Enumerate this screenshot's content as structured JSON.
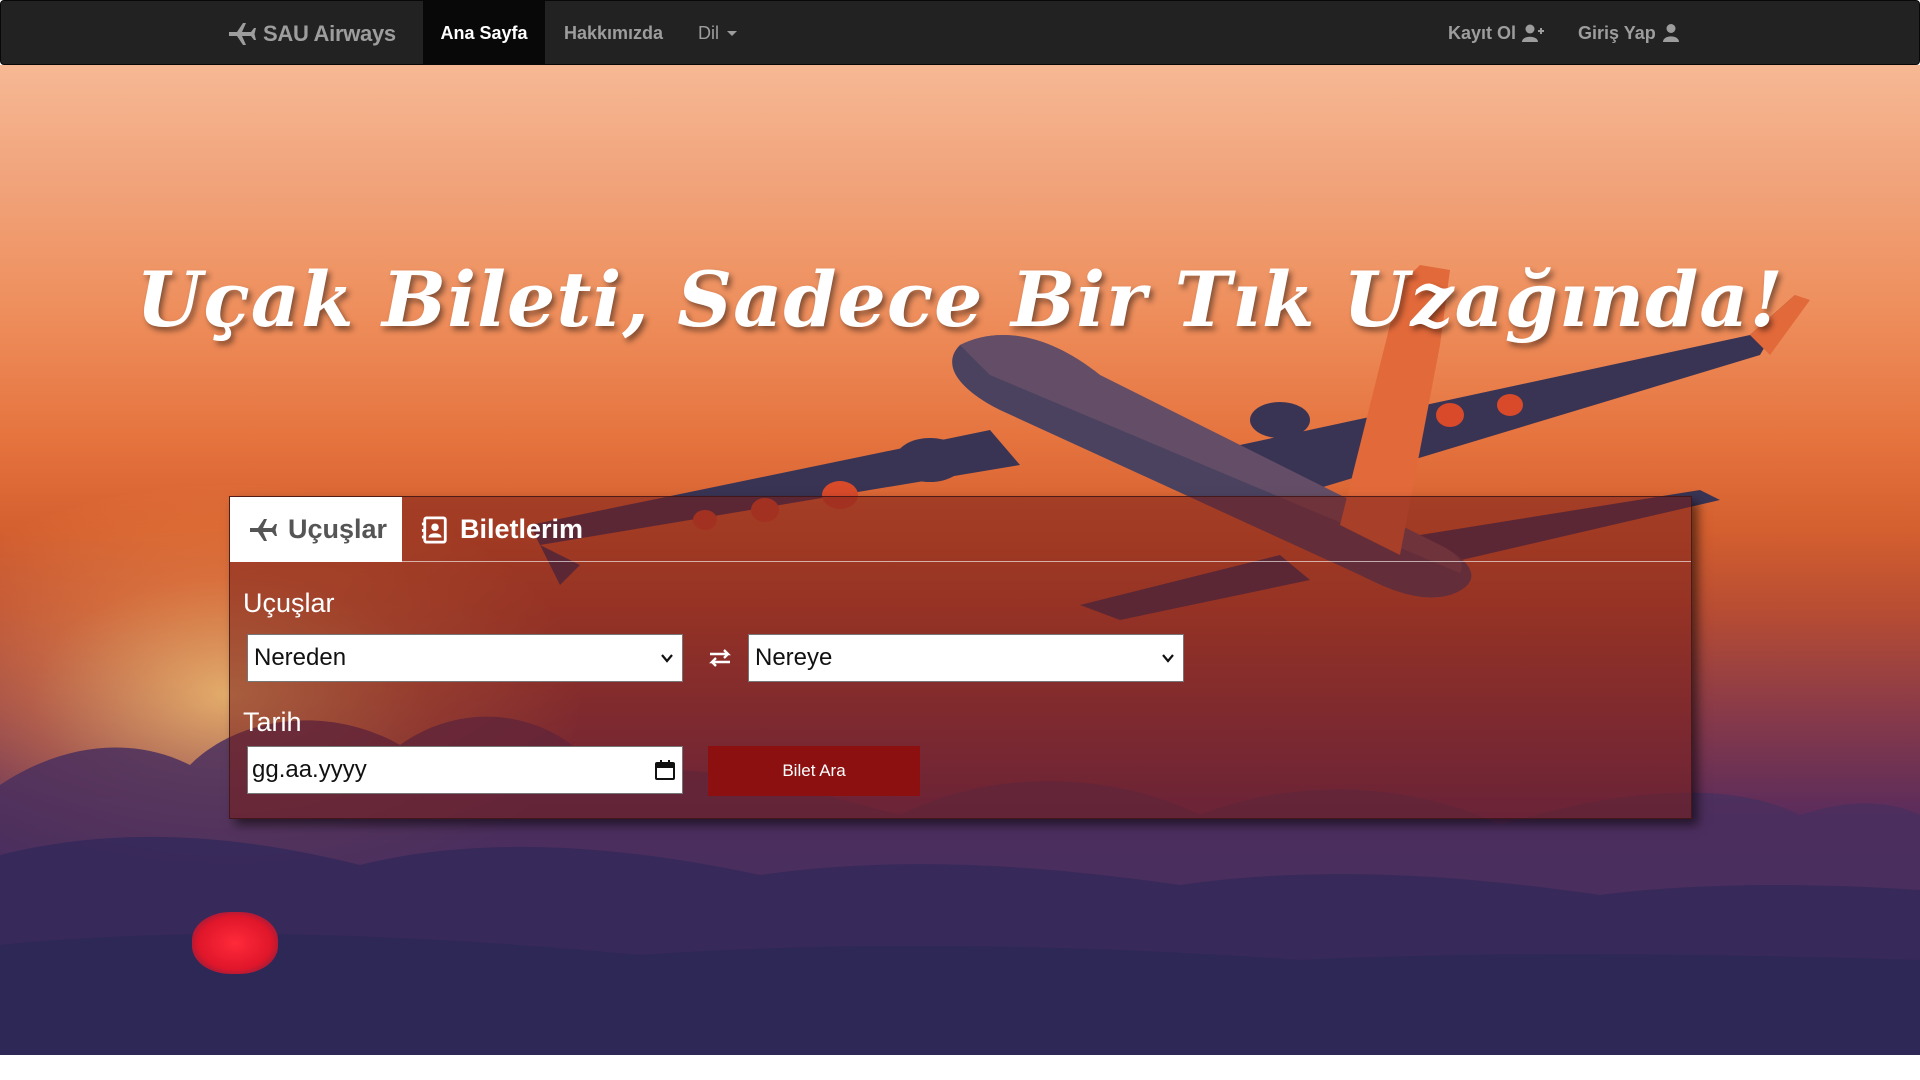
{
  "nav": {
    "brand": "SAU Airways",
    "items": [
      {
        "label": "Ana Sayfa",
        "active": true
      },
      {
        "label": "Hakkımızda",
        "active": false
      },
      {
        "label": "Dil",
        "active": false
      }
    ],
    "register": "Kayıt Ol",
    "login": "Giriş Yap"
  },
  "hero": {
    "headline": "Uçak Bileti, Sadece Bir Tık Uzağında!"
  },
  "search": {
    "tabs": [
      {
        "label": "Uçuşlar",
        "icon": "plane-icon",
        "active": true
      },
      {
        "label": "Biletlerim",
        "icon": "contact-card-icon",
        "active": false
      }
    ],
    "flights_label": "Uçuşlar",
    "from_value": "Nereden",
    "to_value": "Nereye",
    "date_label": "Tarih",
    "date_placeholder": "gg.aa.yyyy",
    "submit_label": "Bilet Ara"
  },
  "colors": {
    "navbar": "#222222",
    "nav_active": "#080808",
    "submit_button": "#8c1010"
  }
}
